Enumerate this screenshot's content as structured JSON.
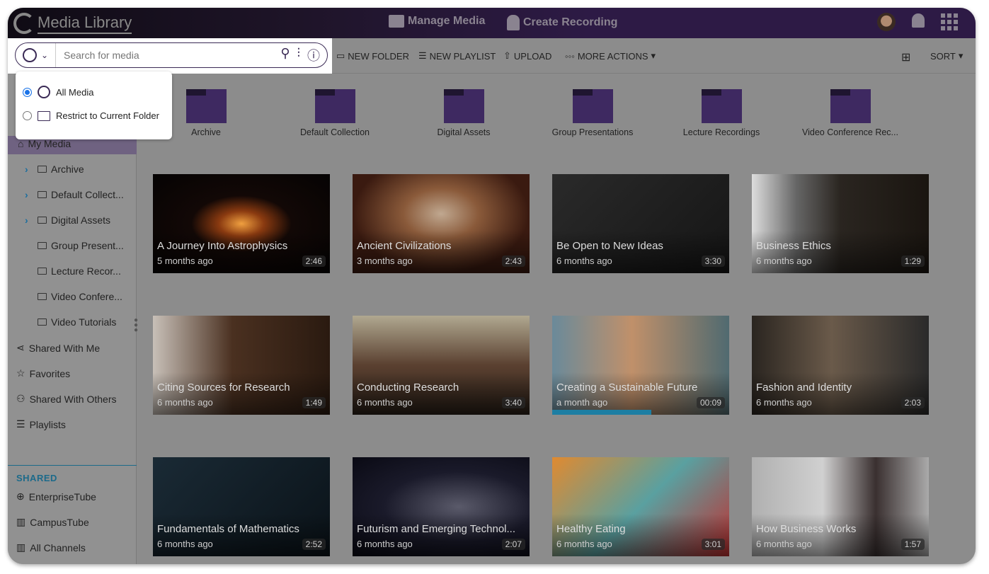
{
  "header": {
    "title": "Media Library",
    "nav": [
      {
        "label": "Manage Media",
        "icon": "video-folder-icon"
      },
      {
        "label": "Create Recording",
        "icon": "recording-icon"
      }
    ]
  },
  "search": {
    "placeholder": "Search for media",
    "scope_icon": "globe-icon"
  },
  "scope_dropdown": {
    "options": [
      {
        "label": "All Media",
        "selected": true
      },
      {
        "label": "Restrict to Current Folder",
        "selected": false
      }
    ]
  },
  "toolbar": {
    "new_folder": "NEW FOLDER",
    "new_playlist": "NEW PLAYLIST",
    "upload": "UPLOAD",
    "more_actions": "MORE ACTIONS",
    "sort": "SORT"
  },
  "sidebar": {
    "my_media": "My Media",
    "folders": [
      {
        "label": "Archive",
        "expandable": true
      },
      {
        "label": "Default Collect...",
        "expandable": true
      },
      {
        "label": "Digital Assets",
        "expandable": true
      },
      {
        "label": "Group Present...",
        "expandable": false
      },
      {
        "label": "Lecture Recor...",
        "expandable": false
      },
      {
        "label": "Video Confere...",
        "expandable": false
      },
      {
        "label": "Video Tutorials",
        "expandable": false
      }
    ],
    "items": [
      "Shared With Me",
      "Favorites",
      "Shared With Others",
      "Playlists"
    ],
    "shared_heading": "SHARED",
    "shared": [
      "EnterpriseTube",
      "CampusTube",
      "All Channels"
    ]
  },
  "folders": [
    "Archive",
    "Default Collection",
    "Digital Assets",
    "Group Presentations",
    "Lecture Recordings",
    "Video Conference Rec..."
  ],
  "media": [
    {
      "title": "A Journey Into Astrophysics",
      "age": "5 months ago",
      "duration": "2:46",
      "bg": "radial-gradient(ellipse at 50% 50%,#f0a040 0%,#8a3a10 18%,#120806 40%,#050303 100%)"
    },
    {
      "title": "Ancient Civilizations",
      "age": "3 months ago",
      "duration": "2:43",
      "bg": "radial-gradient(ellipse at 50% 40%,#c0a890 0%,#8a5a3a 30%,#3a1a10 70%)"
    },
    {
      "title": "Be Open to New Ideas",
      "age": "6 months ago",
      "duration": "3:30",
      "bg": "linear-gradient(135deg,#2a2a2a,#151515)"
    },
    {
      "title": "Business Ethics",
      "age": "6 months ago",
      "duration": "1:29",
      "bg": "linear-gradient(90deg,#ddd 0%,#666 25%,#2a2520 50%,#1a1510 100%)"
    },
    {
      "title": "Citing Sources for Research",
      "age": "6 months ago",
      "duration": "1:49",
      "bg": "linear-gradient(90deg,#c8c0b8 0%,#4a3020 45%,#2a1a10 100%)"
    },
    {
      "title": "Conducting Research",
      "age": "6 months ago",
      "duration": "3:40",
      "bg": "linear-gradient(180deg,#b0a890 0%,#5a4030 50%,#2a2018 100%)"
    },
    {
      "title": "Creating a Sustainable Future",
      "age": "a month ago",
      "duration": "00:09",
      "progress": 56,
      "bg": "linear-gradient(90deg,#6a8a9a 0%,#c0906a 45%,#506a70 100%)"
    },
    {
      "title": "Fashion and Identity",
      "age": "6 months ago",
      "duration": "2:03",
      "bg": "linear-gradient(90deg,#2a2520 0%,#6a5a4a 45%,#2a2a2a 100%)"
    },
    {
      "title": "Fundamentals of Mathematics",
      "age": "6 months ago",
      "duration": "2:52",
      "bg": "linear-gradient(135deg,#1a2a35,#0a1218)"
    },
    {
      "title": "Futurism and Emerging Technol...",
      "age": "6 months ago",
      "duration": "2:07",
      "bg": "radial-gradient(ellipse at 60% 50%,#5a5a6a 0%,#1a1a2a 50%,#0a0a14 100%)"
    },
    {
      "title": "Healthy Eating",
      "age": "6 months ago",
      "duration": "3:01",
      "bg": "linear-gradient(135deg,#e08a30,#5aa0a0 50%,#c03030)"
    },
    {
      "title": "How Business Works",
      "age": "6 months ago",
      "duration": "1:57",
      "bg": "linear-gradient(90deg,#b0b0b0 0%,#d0d0d0 40%,#3a3030 70%,#aaa 100%)"
    }
  ]
}
